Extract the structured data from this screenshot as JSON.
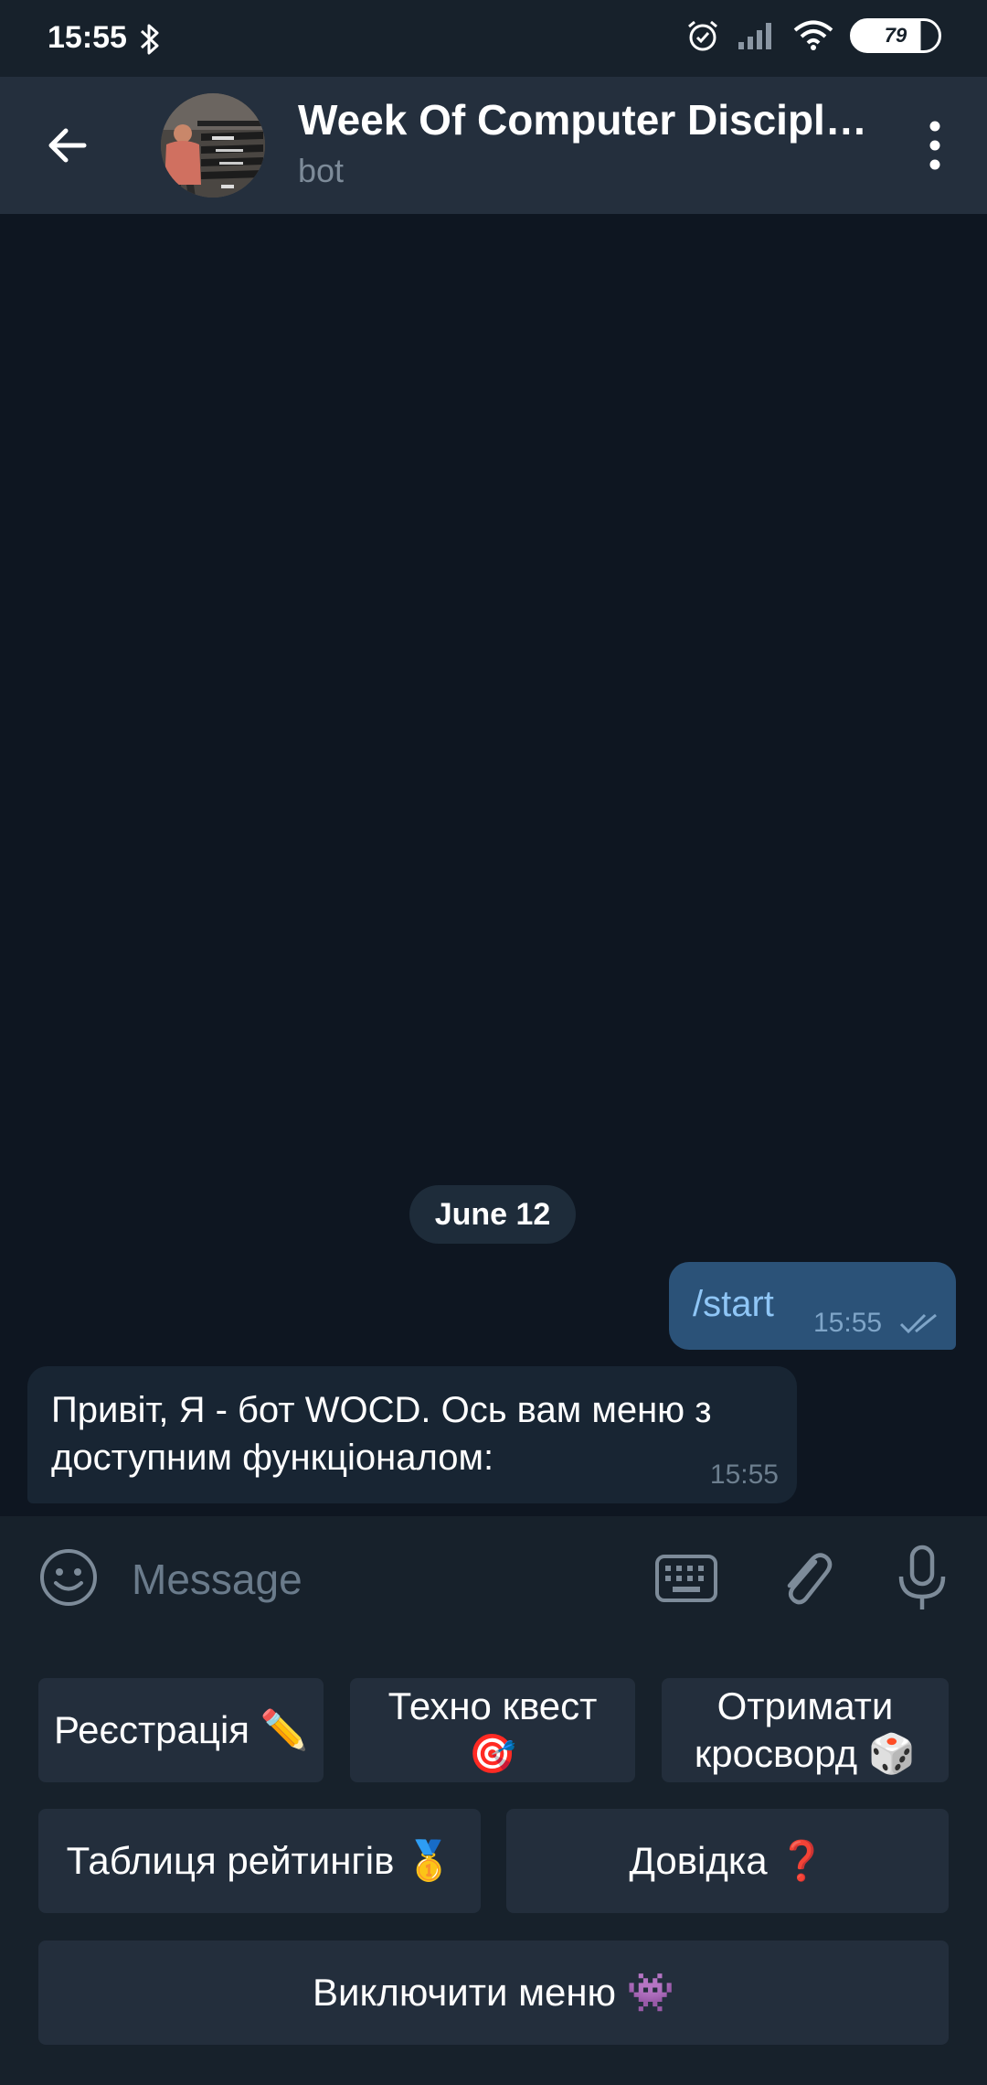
{
  "status_bar": {
    "time": "15:55",
    "battery": "79"
  },
  "header": {
    "title": "Week Of Computer Discipl…",
    "subtitle": "bot"
  },
  "chat": {
    "date_label": "June 12",
    "outgoing": {
      "text": "/start",
      "time": "15:55"
    },
    "incoming": {
      "text": "Привіт, Я - бот WOCD. Ось вам меню з доступним функціоналом:",
      "time": "15:55"
    }
  },
  "input": {
    "placeholder": "Message"
  },
  "keyboard": {
    "registration": "Реєстрація ✏️",
    "tech_quest": "Техно квест 🎯",
    "crossword": "Отримати кросворд 🎲",
    "ratings": "Таблиця рейтингів 🥇",
    "help": "Довідка ❓",
    "disable_menu": "Виключити меню 👾"
  },
  "colors": {
    "background": "#0e1621",
    "header": "#242f3d",
    "outgoing_bubble": "#2b5278",
    "incoming_bubble": "#182533",
    "button": "#232e3c",
    "accent": "#8fc6f6"
  },
  "icons": {
    "back": "arrow-left-icon",
    "menu": "more-vertical-icon",
    "emoji": "smile-icon",
    "keyboard": "keyboard-icon",
    "attach": "paperclip-icon",
    "mic": "microphone-icon"
  }
}
